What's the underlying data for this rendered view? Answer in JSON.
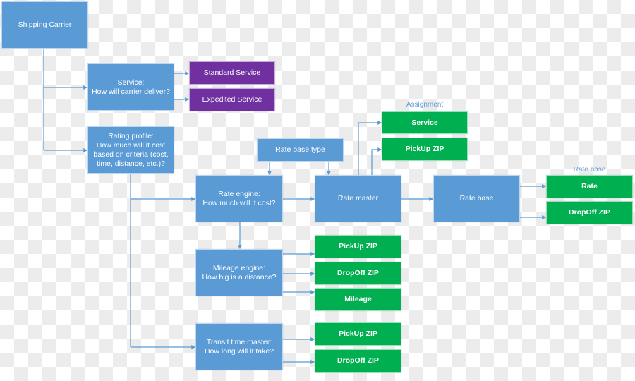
{
  "colors": {
    "process": "#5b9bd5",
    "service": "#7030a0",
    "attribute": "#00b050",
    "connector": "#5b9bd5"
  },
  "nodes": {
    "shipping_carrier": "Shipping Carrier",
    "service": "Service:\nHow will carrier deliver?",
    "standard_service": "Standard Service",
    "expedited_service": "Expedited Service",
    "rating_profile": "Rating profile:\nHow much will it cost\nbased on criteria (cost,\ntime, distance, etc.)?",
    "rate_base_type": "Rate base type",
    "rate_engine": "Rate engine:\nHow much will it cost?",
    "rate_master": "Rate master",
    "rate_base": "Rate base",
    "assignment_service": "Service",
    "assignment_pickup_zip": "PickUp ZIP",
    "rate": "Rate",
    "rate_base_dropoff_zip": "DropOff ZIP",
    "mileage_engine": "Mileage engine:\nHow big is a distance?",
    "mileage_pickup_zip": "PickUp ZIP",
    "mileage_dropoff_zip": "DropOff ZIP",
    "mileage": "Mileage",
    "transit_time_master": "Transit time master:\nHow long will it take?",
    "transit_pickup_zip": "PickUp ZIP",
    "transit_dropoff_zip": "DropOff ZIP"
  },
  "group_labels": {
    "assignment": "Assignment",
    "rate_base": "Rate base"
  }
}
